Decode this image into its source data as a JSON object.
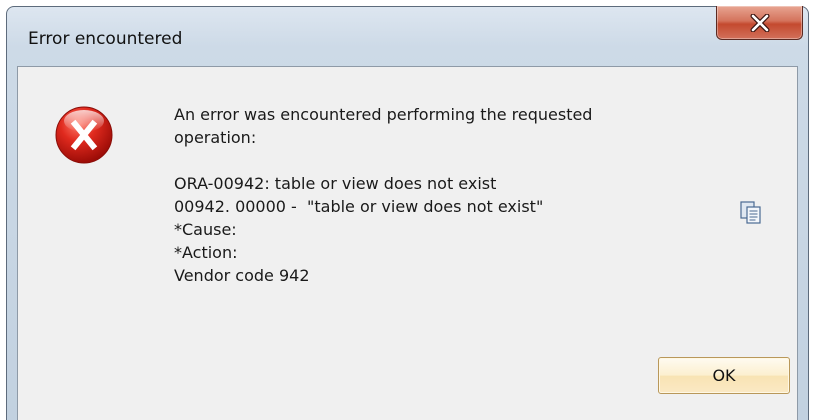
{
  "window": {
    "title": "Error encountered",
    "close_label": "X"
  },
  "dialog": {
    "icon": "error-icon",
    "message_lines": [
      "An error was encountered performing the requested",
      "operation:",
      "",
      "ORA-00942: table or view does not exist",
      "00942. 00000 -  \"table or view does not exist\"",
      "*Cause:",
      "*Action:",
      "Vendor code 942"
    ],
    "copy_icon": "copy-icon",
    "ok_label": "OK"
  },
  "colors": {
    "error_red": "#d21f1f",
    "ok_border": "#b9985a",
    "close_red": "#c44a2f"
  }
}
